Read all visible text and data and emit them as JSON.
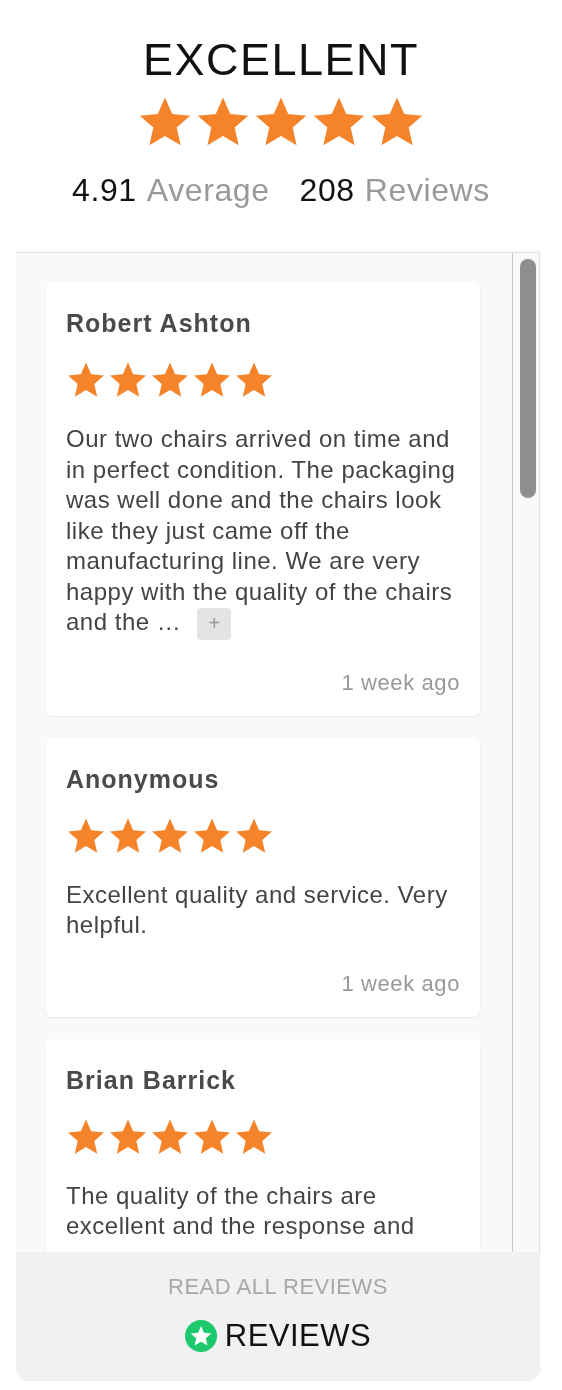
{
  "header": {
    "rating_word": "EXCELLENT",
    "stars": 5,
    "average": "4.91",
    "average_label": "Average",
    "count": "208",
    "count_label": "Reviews"
  },
  "reviews": [
    {
      "author": "Robert Ashton",
      "stars": 5,
      "text": "Our two chairs arrived on time and in perfect condition. The packaging was well done and the chairs look like they just came off the manufacturing line. We are very happy with the quality of the chairs and the …",
      "more_label": "+",
      "date": "1 week ago"
    },
    {
      "author": "Anonymous",
      "stars": 5,
      "text": "Excellent quality and service. Very helpful.",
      "date": "1 week ago"
    },
    {
      "author": "Brian Barrick",
      "stars": 5,
      "text": "The quality of the chairs are excellent and the response and"
    }
  ],
  "footer": {
    "link": "READ ALL REVIEWS",
    "brand": "REVIEWS"
  }
}
